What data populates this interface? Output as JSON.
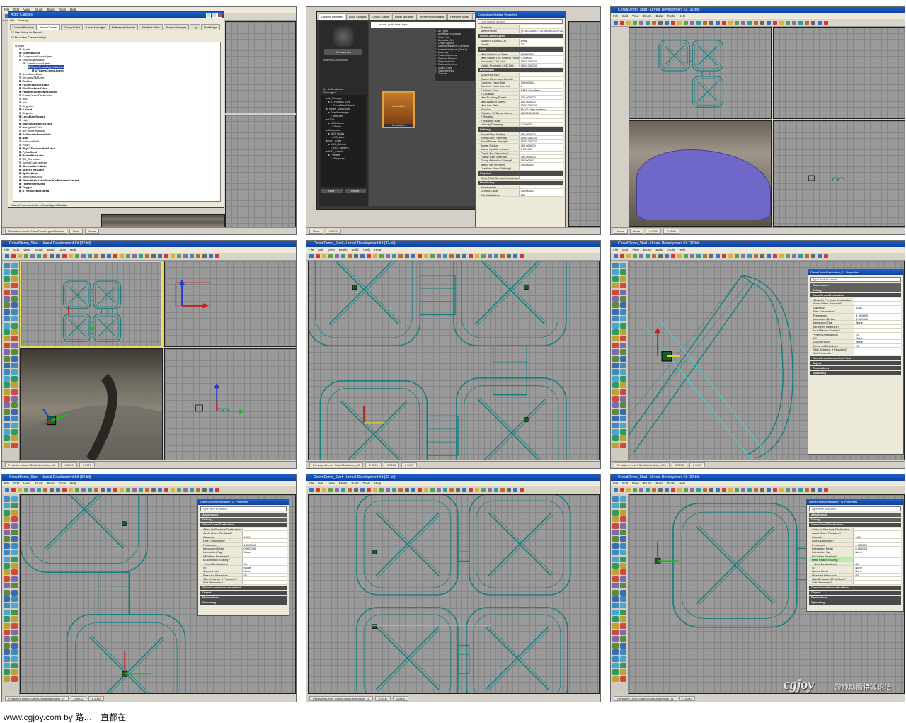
{
  "window_title": "CrowdDemo_Start - Unreal Development Kit (32-bit)",
  "menu": [
    "File",
    "Edit",
    "View",
    "Brush",
    "Build",
    "Tools",
    "Help"
  ],
  "viewport_status": {
    "persistent_level": "Persistent Level: GameCrowdDestination_11",
    "fields": [
      "0.0000",
      "0.0000",
      "0.0000"
    ],
    "none": "None"
  },
  "status_tiles": {
    "t1": "Persistent Level: GameCrowdAgentSkeletal",
    "t5": "Persistent Level: StaticMeshActor_10",
    "t6": "Persistent Level: StaticMeshActor_104",
    "t7": "Persistent Level: GameCrowdDestination_11",
    "t8": "Persistent Level: GameCrowdDestination_11",
    "t9": "Persistent Level: GameCrowdDestination_11"
  },
  "actor_classes": {
    "title": "Actor Classes",
    "menu": [
      "File",
      "Docking"
    ],
    "tabs": [
      "Content Browser",
      "Actor Classes",
      "Group Editor",
      "Level Manager",
      "Referenced Assets",
      "Primitive Stats",
      "Scene Manager",
      "Log",
      "Start Page"
    ],
    "options": [
      "Use 'Actor' As Parent?",
      "Placeable Classes Only?"
    ],
    "tree": [
      {
        "t": "Actor",
        "d": 0,
        "b": false
      },
      {
        "t": "Brush",
        "d": 1,
        "b": false
      },
      {
        "t": "CameraActor",
        "d": 1,
        "b": true
      },
      {
        "t": "ComponentCrowdAgent",
        "d": 1,
        "b": false
      },
      {
        "t": "CrowdAgentBase",
        "d": 1,
        "b": false
      },
      {
        "t": "GameCrowdAgent",
        "d": 2,
        "b": false
      },
      {
        "t": "GameCrowdAgentSkeletal",
        "d": 3,
        "b": false,
        "sel": true
      },
      {
        "t": "UTGameCrowdAgent",
        "d": 4,
        "b": true
      },
      {
        "t": "DecalActorBase",
        "d": 1,
        "b": false
      },
      {
        "t": "DynamicSMActor",
        "d": 1,
        "b": false
      },
      {
        "t": "Emitter",
        "d": 1,
        "b": true
      },
      {
        "t": "FluidInfluenceActor",
        "d": 1,
        "b": true
      },
      {
        "t": "FluidSurfaceActor",
        "d": 1,
        "b": true
      },
      {
        "t": "FracturedStaticMeshActor",
        "d": 1,
        "b": true
      },
      {
        "t": "GameCrowdDestination",
        "d": 1,
        "b": false
      },
      {
        "t": "HUD",
        "d": 1,
        "b": false
      },
      {
        "t": "Info",
        "d": 1,
        "b": false
      },
      {
        "t": "Keypoint",
        "d": 1,
        "b": false
      },
      {
        "t": "KAsset",
        "d": 1,
        "b": true
      },
      {
        "t": "Keypoint",
        "d": 1,
        "b": false
      },
      {
        "t": "LensFlareSource",
        "d": 1,
        "b": true
      },
      {
        "t": "Light",
        "d": 1,
        "b": false
      },
      {
        "t": "MaterialInstanceActor",
        "d": 1,
        "b": true
      },
      {
        "t": "NavigationPoint",
        "d": 1,
        "b": false
      },
      {
        "t": "NxForceFieldBase",
        "d": 1,
        "b": false
      },
      {
        "t": "NxGenericForceField",
        "d": 1,
        "b": true
      },
      {
        "t": "Note",
        "d": 1,
        "b": true
      },
      {
        "t": "NxForceField",
        "d": 1,
        "b": false
      },
      {
        "t": "Pawn",
        "d": 1,
        "b": false
      },
      {
        "t": "PhysXDestructibleActor",
        "d": 1,
        "b": true
      },
      {
        "t": "PylonSeed",
        "d": 1,
        "b": true
      },
      {
        "t": "RadialBlurActor",
        "d": 1,
        "b": true
      },
      {
        "t": "RB_Constraint",
        "d": 1,
        "b": false
      },
      {
        "t": "SceneCaptureActor",
        "d": 1,
        "b": false
      },
      {
        "t": "SkeletalMeshActor",
        "d": 1,
        "b": true
      },
      {
        "t": "SpeedTreeActor",
        "d": 1,
        "b": true
      },
      {
        "t": "SplineActor",
        "d": 1,
        "b": true
      },
      {
        "t": "StaticMeshActor",
        "d": 1,
        "b": false
      },
      {
        "t": "StaticMeshActorBasedOnExtremeContent",
        "d": 1,
        "b": true
      },
      {
        "t": "TextRenderActor",
        "d": 1,
        "b": true
      },
      {
        "t": "Trigger",
        "d": 1,
        "b": true
      },
      {
        "t": "UTVehicleBoostPad",
        "d": 1,
        "b": true
      }
    ],
    "status": "GameFramework.GameCrowdAgentSkeletal"
  },
  "content_browser": {
    "title": "Content Browser",
    "tabs": [
      "Content Browser",
      "Actor Classes",
      "Group Editor",
      "Level Manager",
      "Referenced Assets",
      "Primitive Stats",
      "Scene Manager",
      "Log"
    ],
    "search_placeholder": "name, path, tags, type",
    "shared_collections": "Shared Collections",
    "my_collections": "My Collections",
    "packages": "Packages",
    "new_favorites": "All Favorites",
    "package_items": [
      "A_Pickups",
      "A_Pickups_Dyn",
      "GamePlayObjects",
      "Tunes_Weapons",
      "StartPackages",
      "Textures",
      "UDK",
      "UDKGame",
      "Effects",
      "Materials",
      "WG_Boids",
      "WG_Boo",
      "WG_Flare",
      "WG_Robots",
      "WG_Spiders",
      "WG_Scripts",
      "Prefabs",
      "Weapons"
    ],
    "asset_label": "CrowdSet",
    "asset_caption": "CrowdActor",
    "buttons": [
      "New",
      "Import"
    ],
    "type_filters": [
      "All Types",
      "Animation Sequence",
      "Anim Tree",
      "Animation Set",
      "Crowd Agents",
      "Material Instance (Constant)",
      "Material Instance (Time V)",
      "Materials",
      "Particle Systems",
      "Physical Material",
      "Physics Assets",
      "Skeletal Meshes",
      "Sound Cues",
      "Static Meshes",
      "Textures"
    ]
  },
  "props_top": {
    "title": "CrowdAgentSkeletal Properties",
    "search": "Type here to search",
    "sections": [
      {
        "name": "",
        "rows": [
          [
            "Skeleton",
            ""
          ],
          [
            "Mesh Prefab",
            "(X=0.000000,Y=0.000000,Z=0.000000)"
          ]
        ]
      },
      {
        "name": "GameCrowdAgent",
        "rows": [
          [
            "Ambient Sound Cue",
            "None"
          ],
          [
            "Health",
            "20"
          ]
        ]
      },
      {
        "name": "LOD",
        "rows": [
          [
            "Max Visible Lod Span",
            "80.000000"
          ],
          [
            "Max Visible Tick Scaling Factor",
            "0.500000"
          ],
          [
            "Proximity LOD Dist",
            "1500.000000"
          ],
          [
            "Visible Proximity LOD Dist",
            "5000.000000"
          ]
        ]
      },
      {
        "name": "Movement",
        "rows": [
          [
            "Allow Pitching?",
            ""
          ],
          [
            "Clamp Movement Speed?",
            ""
          ],
          [
            "Conform Trace Dist",
            "35.000000"
          ],
          [
            "Conform Trace Interval",
            "5"
          ],
          [
            "Conform Type",
            "CFM_NavMesh"
          ],
          [
            "+ Location",
            ""
          ],
          [
            "Max Running Speed",
            "300.000000"
          ],
          [
            "Max Walking Speed",
            "200.000000"
          ],
          [
            "Max Yaw Rate",
            "1000.000000"
          ],
          [
            "Physics",
            "PHYS_Interpolating"
          ],
          [
            "Rotation To Target Speed",
            "60000.000000"
          ],
          [
            "+ Rotation",
            ""
          ],
          [
            "+ Rotation Rate",
            ""
          ],
          [
            "Velocity Damping",
            "0.000000"
          ]
        ]
      },
      {
        "name": "Pathing",
        "rows": [
          [
            "Avoid Other Radius",
            "100.000000"
          ],
          [
            "Avoid Other Strength",
            "5000.000000"
          ],
          [
            "Avoid Player Strength",
            "1000.000000"
          ],
          [
            "Aware Radius",
            "200.000000"
          ],
          [
            "Aware Update Interval",
            "0.500000"
          ],
          [
            "Check For Obstacles?",
            ""
          ],
          [
            "Follow Path Strength",
            "300.000000"
          ],
          [
            "Group Attraction Strength",
            "50.000000"
          ],
          [
            "Match Vel Strength",
            "40.000000"
          ],
          [
            "Use Nav Mesh Pathing?",
            ""
          ]
        ]
      },
      {
        "name": "Physics",
        "rows": [
          [
            "Allow Fluid Surface Interaction",
            ""
          ]
        ]
      },
      {
        "name": "Rendering",
        "rows": [
          [
            "Attachments",
            "..."
          ],
          [
            "Ground Offset",
            "40.000000"
          ],
          [
            "Bot Validations",
            "100"
          ]
        ]
      }
    ]
  },
  "props_dest": {
    "title": "GameCrowdDestination_11 Properties",
    "search": "Type here to search",
    "sections": [
      "Attachment",
      "Debug",
      "GameCrowdDestination"
    ],
    "rows": [
      [
        "Allow As Previous Destination",
        ""
      ],
      [
        "Avoid When Panicked?",
        ""
      ],
      [
        "Capacity",
        "1000"
      ],
      [
        "Flee Destination?",
        ""
      ],
      [
        "Frequency",
        "1.000000"
      ],
      [
        "Interaction Delay",
        "0.000000"
      ],
      [
        "Interaction Tag",
        "None"
      ],
      [
        "Kill When Reached?",
        ""
      ],
      [
        "Must Reach Exactly?",
        ""
      ],
      [
        "+ Next Destinations",
        "(1)"
      ],
      [
        "[0]",
        "None"
      ],
      [
        "Queue Head",
        "None"
      ],
      [
        "Reached Behaviors",
        "(0)"
      ],
      [
        "Skip Behavior If Panicked?",
        ""
      ],
      [
        "Soft Perimeter?",
        ""
      ]
    ],
    "after": [
      "GameCrowdInteractionPoint",
      "Object",
      "Restrictions",
      "Spawning"
    ]
  },
  "caption": "www.cgjoy.com by 路…一直都在",
  "watermark": "cgjoy",
  "watermark_cn": "游戏动画特效论坛"
}
